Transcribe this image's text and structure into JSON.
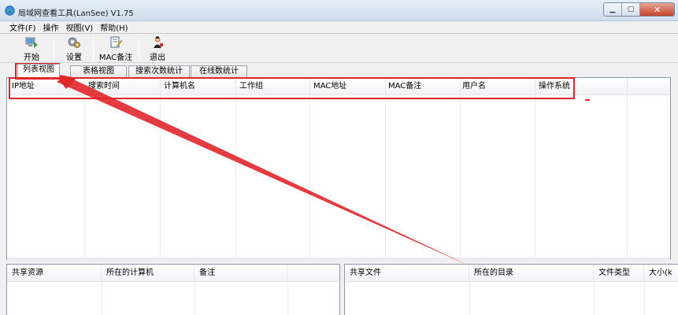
{
  "window": {
    "title": "局域网查看工具(LanSee) V1.75",
    "minimize_glyph": "▁",
    "maximize_glyph": "▢",
    "close_glyph": "✕"
  },
  "menubar": {
    "items": [
      "文件(F)",
      "操作",
      "视图(V)",
      "帮助(H)"
    ]
  },
  "toolbar": {
    "start_label": "开始",
    "settings_label": "设置",
    "mac_note_label": "MAC备注",
    "exit_label": "退出"
  },
  "tabs": {
    "items": [
      "列表视图",
      "表格视图",
      "搜索次数统计",
      "在线数统计"
    ],
    "active_index": 0
  },
  "main_list": {
    "columns": [
      "IP地址",
      "搜索时间",
      "计算机名",
      "工作组",
      "MAC地址",
      "MAC备注",
      "用户名",
      "操作系统"
    ]
  },
  "share_pane": {
    "columns": [
      "共享资源",
      "所在的计算机",
      "备注"
    ]
  },
  "file_pane": {
    "columns": [
      "共享文件",
      "所在的目录",
      "文件类型",
      "大小(k"
    ]
  },
  "icons": {
    "app": "network-globe-icon",
    "start": "start-computer-icon",
    "settings": "gear-settings-icon",
    "mac_note": "note-edit-icon",
    "exit": "exit-person-icon"
  },
  "colors": {
    "annotation": "#e0262a",
    "title_bar": "#d9e4f1",
    "close_button": "#c4432a"
  }
}
